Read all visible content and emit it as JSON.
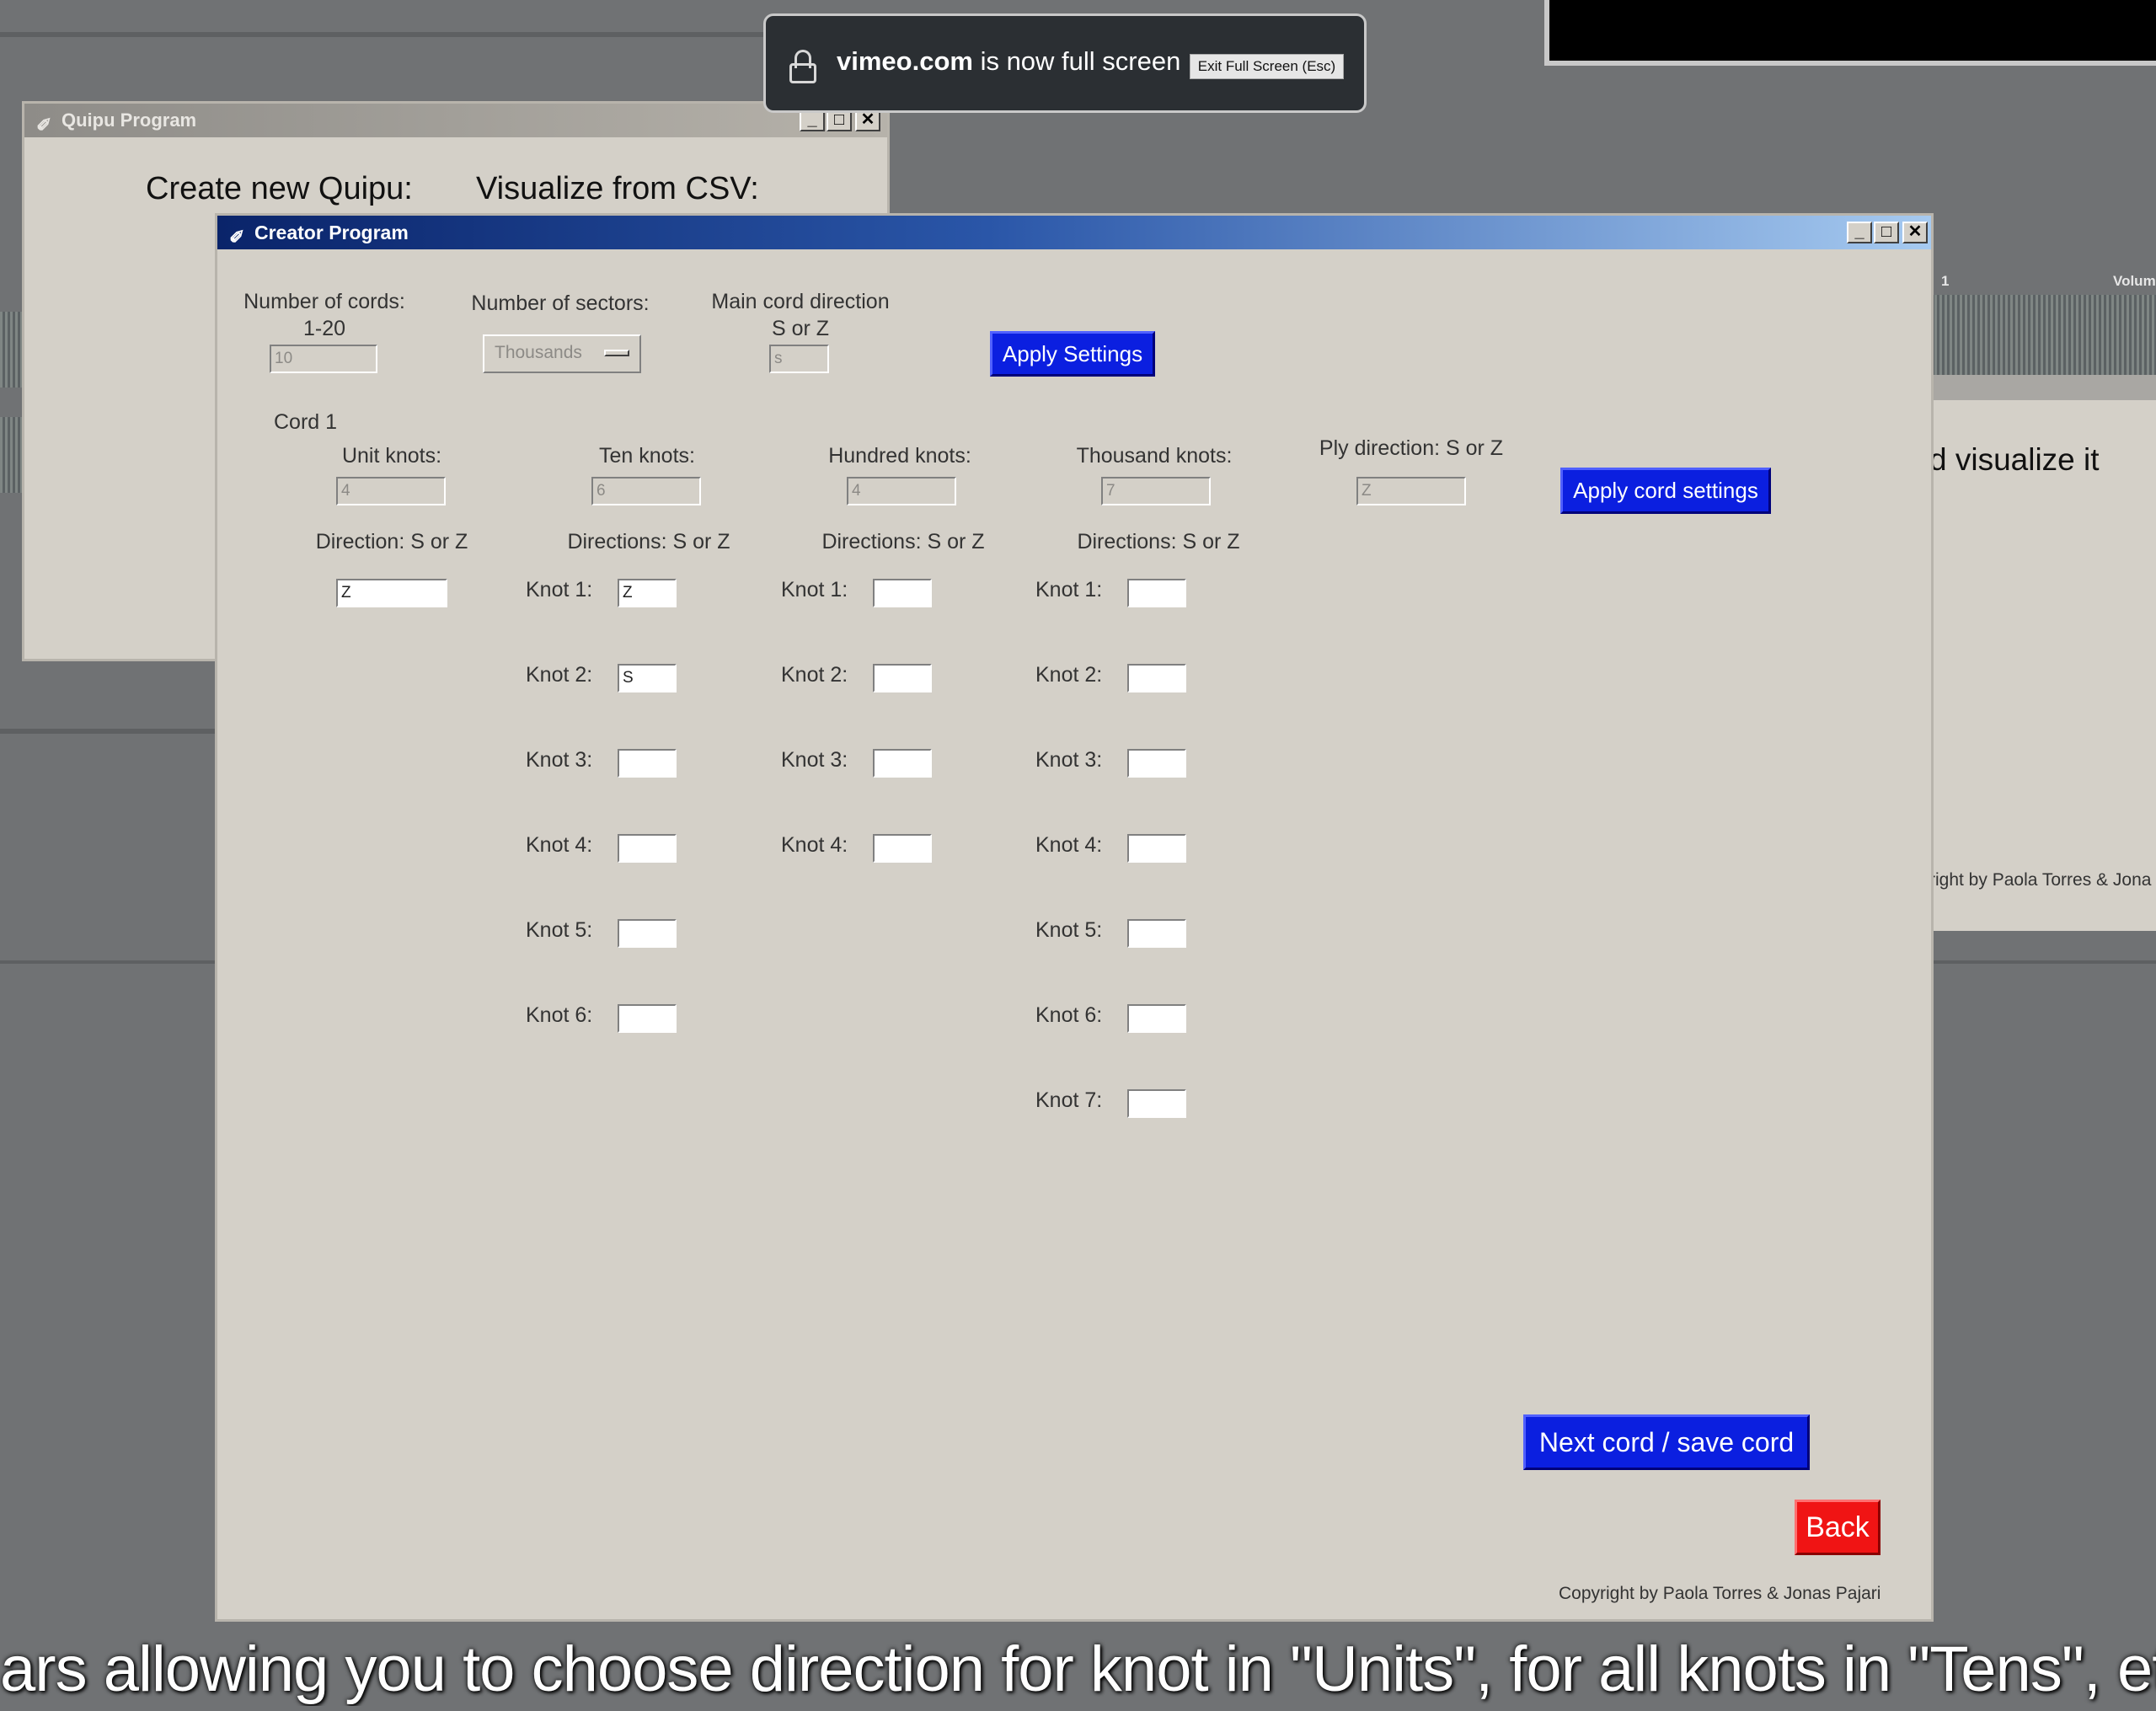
{
  "notification": {
    "domain": "vimeo.com",
    "message": " is now full screen",
    "exit_button": "Exit Full Screen (Esc)"
  },
  "bg_window": {
    "title": "Quipu Program",
    "create_label": "Create new Quipu:",
    "visualize_label": "Visualize from CSV:"
  },
  "right_window": {
    "header_1": "1",
    "header_volume": "Volum",
    "visualize_fragment": "d visualize it",
    "copyright_fragment": "right by Paola Torres & Jona"
  },
  "creator": {
    "title": "Creator Program",
    "num_cords_label": "Number of cords:",
    "num_cords_range": "1-20",
    "num_cords_value": "10",
    "num_sectors_label": "Number of sectors:",
    "num_sectors_value": "Thousands",
    "main_dir_label": "Main cord direction",
    "main_dir_sub": "S or Z",
    "main_dir_value": "s",
    "apply_settings": "Apply Settings",
    "cord_label": "Cord 1",
    "unit_label": "Unit knots:",
    "unit_value": "4",
    "ten_label": "Ten knots:",
    "ten_value": "6",
    "hundred_label": "Hundred knots:",
    "hundred_value": "4",
    "thousand_label": "Thousand knots:",
    "thousand_value": "7",
    "ply_label": "Ply direction: S or Z",
    "ply_value": "Z",
    "apply_cord": "Apply cord settings",
    "unit_dir_label": "Direction: S or Z",
    "unit_dir_value": "Z",
    "dirs_label": "Directions: S or Z",
    "tens": [
      {
        "label": "Knot 1:",
        "value": "Z"
      },
      {
        "label": "Knot 2:",
        "value": "S"
      },
      {
        "label": "Knot 3:",
        "value": ""
      },
      {
        "label": "Knot 4:",
        "value": ""
      },
      {
        "label": "Knot 5:",
        "value": ""
      },
      {
        "label": "Knot 6:",
        "value": ""
      }
    ],
    "hundreds": [
      {
        "label": "Knot 1:",
        "value": ""
      },
      {
        "label": "Knot 2:",
        "value": ""
      },
      {
        "label": "Knot 3:",
        "value": ""
      },
      {
        "label": "Knot 4:",
        "value": ""
      }
    ],
    "thousands": [
      {
        "label": "Knot 1:",
        "value": ""
      },
      {
        "label": "Knot 2:",
        "value": ""
      },
      {
        "label": "Knot 3:",
        "value": ""
      },
      {
        "label": "Knot 4:",
        "value": ""
      },
      {
        "label": "Knot 5:",
        "value": ""
      },
      {
        "label": "Knot 6:",
        "value": ""
      },
      {
        "label": "Knot 7:",
        "value": ""
      }
    ],
    "next_cord": "Next cord / save cord",
    "back": "Back",
    "copyright": "Copyright by Paola Torres & Jonas Pajari"
  },
  "subtitle": "ars allowing you to choose direction  for knot in \"Units\", for all knots in \"Tens\", etc. Z or S f"
}
